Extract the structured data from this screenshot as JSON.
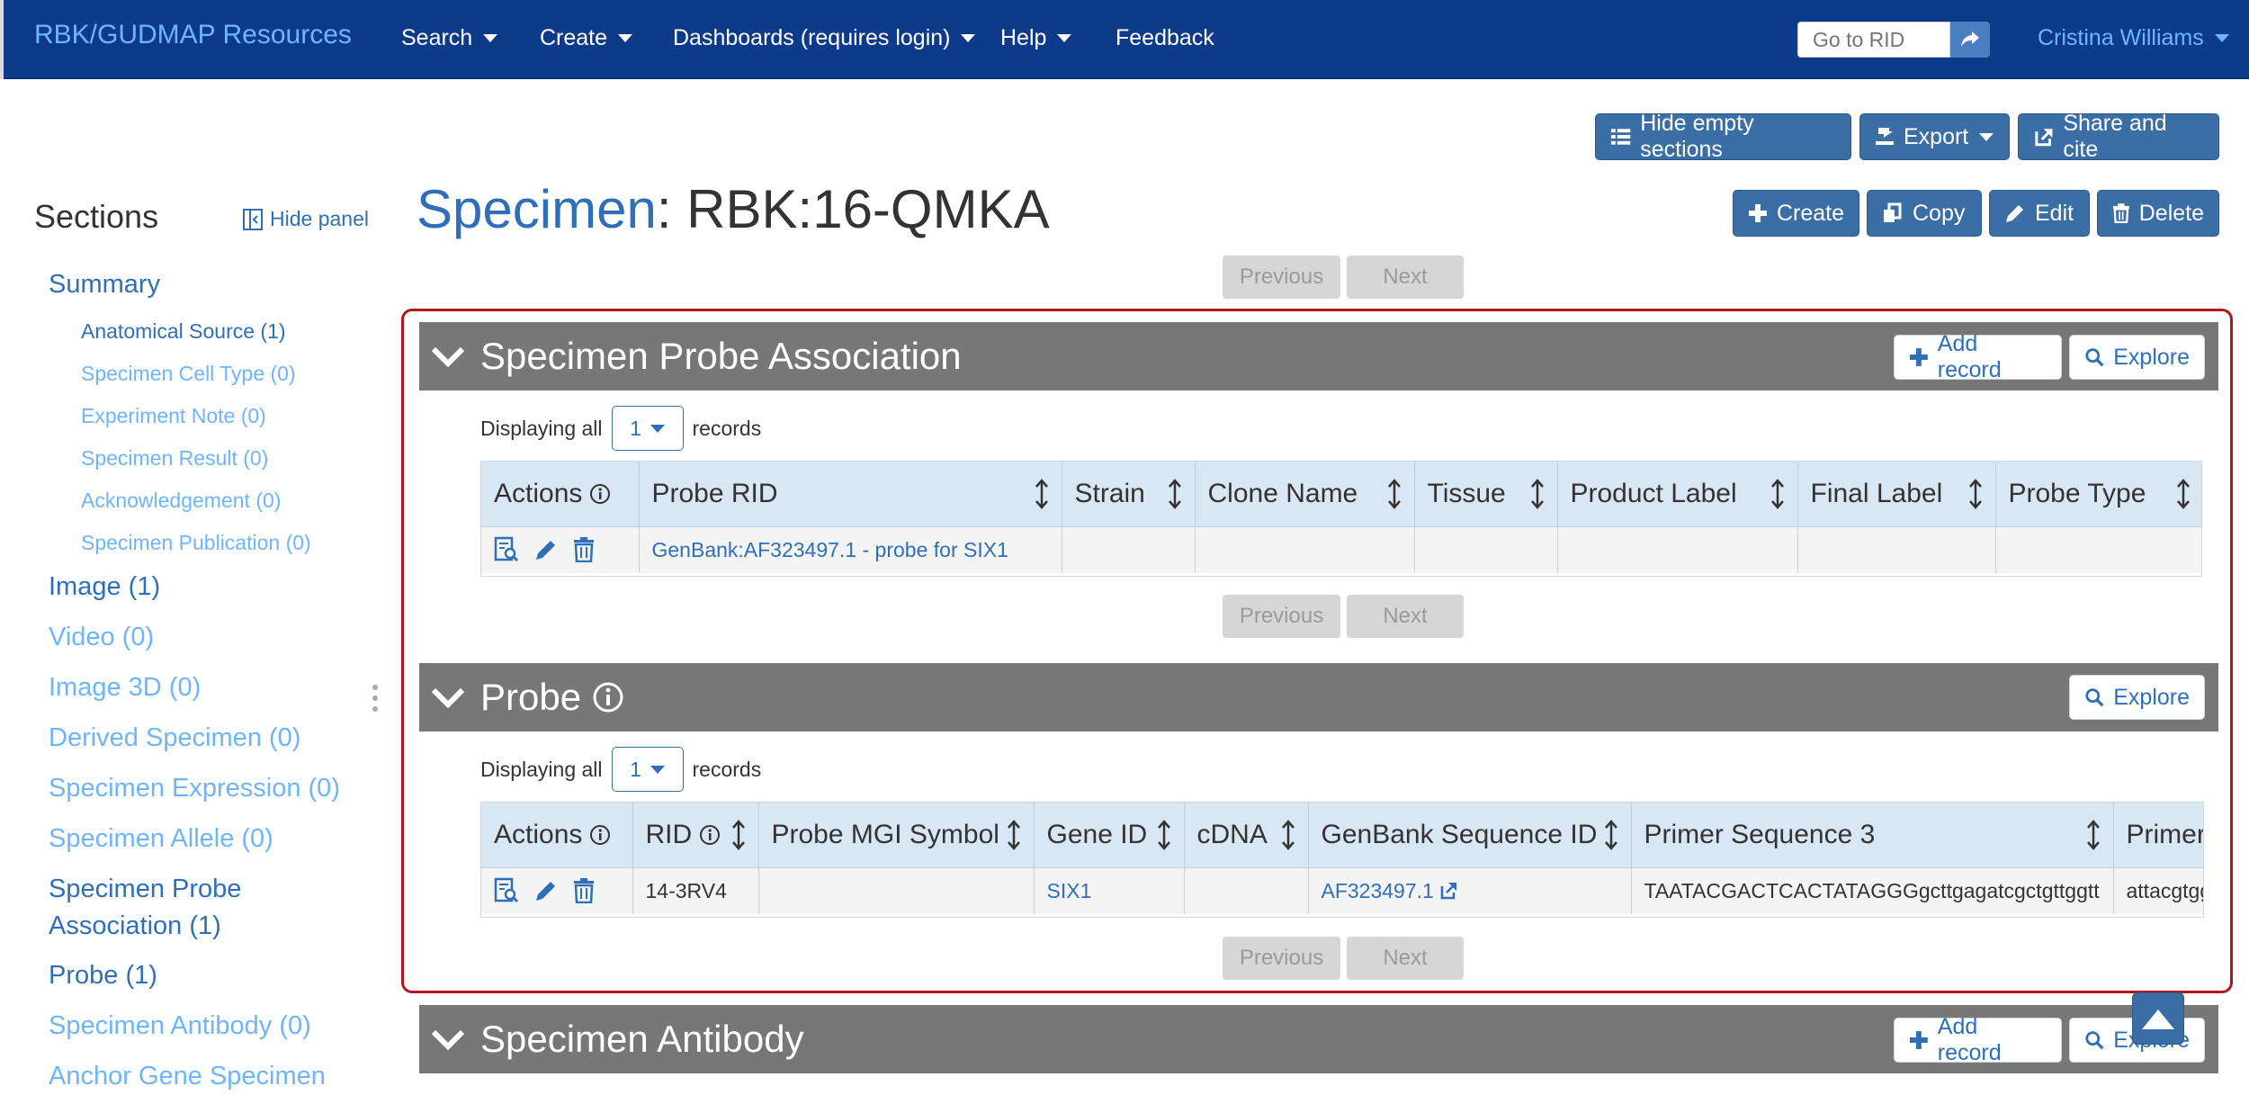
{
  "nav": {
    "brand": "RBK/GUDMAP Resources",
    "items": [
      {
        "label": "Search"
      },
      {
        "label": "Create"
      },
      {
        "label": "Dashboards (requires login)"
      },
      {
        "label": "Help"
      },
      {
        "label": "Feedback"
      }
    ],
    "rid_placeholder": "Go to RID",
    "user": "Cristina Williams"
  },
  "toolbar": {
    "hide_empty": "Hide empty sections",
    "export": "Export",
    "share": "Share and cite",
    "create": "Create",
    "copy": "Copy",
    "edit": "Edit",
    "delete": "Delete"
  },
  "title": {
    "table": "Specimen",
    "separator": ":",
    "rid": "RBK:16-QMKA"
  },
  "sidebar": {
    "heading": "Sections",
    "hide_panel": "Hide panel",
    "items": [
      {
        "label": "Summary",
        "active": true
      },
      {
        "label": "Anatomical Source (1)",
        "active": true,
        "sub": true
      },
      {
        "label": "Specimen Cell Type (0)",
        "sub": true
      },
      {
        "label": "Experiment Note (0)",
        "sub": true
      },
      {
        "label": "Specimen Result (0)",
        "sub": true
      },
      {
        "label": "Acknowledgement (0)",
        "sub": true
      },
      {
        "label": "Specimen Publication (0)",
        "sub": true
      },
      {
        "label": "Image (1)",
        "active": true
      },
      {
        "label": "Video (0)"
      },
      {
        "label": "Image 3D (0)"
      },
      {
        "label": "Derived Specimen (0)"
      },
      {
        "label": "Specimen Expression (0)"
      },
      {
        "label": "Specimen Allele (0)"
      },
      {
        "label": "Specimen Probe",
        "active": true
      },
      {
        "label": "Association (1)",
        "active": true
      },
      {
        "label": "Probe (1)",
        "active": true
      },
      {
        "label": "Specimen Antibody (0)"
      },
      {
        "label": "Anchor Gene Specimen"
      }
    ]
  },
  "pagination": {
    "previous": "Previous",
    "next": "Next"
  },
  "section_spa": {
    "title": "Specimen Probe Association",
    "add_record": "Add record",
    "explore": "Explore",
    "display_prefix": "Displaying all",
    "page_size": "1",
    "display_suffix": "records",
    "columns": [
      "Actions",
      "Probe RID",
      "Strain",
      "Clone Name",
      "Tissue",
      "Product Label",
      "Final Label",
      "Probe Type"
    ],
    "row": {
      "probe_rid": "GenBank:AF323497.1 - probe for SIX1"
    }
  },
  "section_probe": {
    "title": "Probe",
    "explore": "Explore",
    "display_prefix": "Displaying all",
    "page_size": "1",
    "display_suffix": "records",
    "columns": [
      "Actions",
      "RID",
      "Probe MGI Symbol",
      "Gene ID",
      "cDNA",
      "GenBank Sequence ID",
      "Primer Sequence 3",
      "Primer"
    ],
    "row": {
      "rid": "14-3RV4",
      "gene_id": "SIX1",
      "genbank": "AF323497.1",
      "primer3": "TAATACGACTCACTATAGGGgcttgagatcgctgttggtt",
      "primer5": "attacgtgg"
    }
  },
  "section_antibody": {
    "title": "Specimen Antibody",
    "add_record": "Add record",
    "explore": "Explore"
  }
}
